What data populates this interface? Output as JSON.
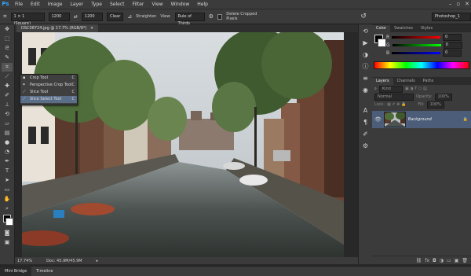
{
  "app": {
    "logo": "Ps"
  },
  "menu": [
    "File",
    "Edit",
    "Image",
    "Layer",
    "Type",
    "Select",
    "Filter",
    "View",
    "Window",
    "Help"
  ],
  "window_controls": [
    "–",
    "▫",
    "✕"
  ],
  "options": {
    "ratio": "1 × 1 (Square)",
    "width": "1200",
    "height": "1200",
    "clear": "Clear",
    "straighten": "Straighten",
    "view_label": "View:",
    "view_value": "Rule of Thirds",
    "delete_cropped": "Delete Cropped Pixels",
    "workspace": "Photoshop_1"
  },
  "document": {
    "tab_title": "DSC08724.jpg @ 17.7% (RGB/8*)",
    "close": "×",
    "zoom": "17.74%",
    "doc_size": "Doc: 45.9M/45.9M"
  },
  "flyout": {
    "items": [
      {
        "label": "Crop Tool",
        "key": "C",
        "icon": "crop-icon"
      },
      {
        "label": "Perspective Crop Tool",
        "key": "C",
        "icon": "perspective-crop-icon"
      },
      {
        "label": "Slice Tool",
        "key": "C",
        "icon": "slice-icon"
      },
      {
        "label": "Slice Select Tool",
        "key": "C",
        "icon": "slice-select-icon"
      }
    ]
  },
  "bottom_tabs": [
    "Mini Bridge",
    "Timeline"
  ],
  "color_panel": {
    "tabs": [
      "Color",
      "Swatches",
      "Styles"
    ],
    "r_label": "R",
    "g_label": "G",
    "b_label": "B",
    "r": "0",
    "g": "0",
    "b": "0"
  },
  "layers_panel": {
    "tabs": [
      "Layers",
      "Channels",
      "Paths"
    ],
    "kind": "Kind",
    "blend": "Normal",
    "opacity_label": "Opacity:",
    "opacity": "100%",
    "lock_label": "Lock:",
    "fill_label": "Fill:",
    "fill": "100%",
    "layer_name": "Background"
  },
  "colors": {
    "accent": "#31a8ff",
    "selection": "#4b5d78",
    "panel": "#3b3b3b"
  }
}
